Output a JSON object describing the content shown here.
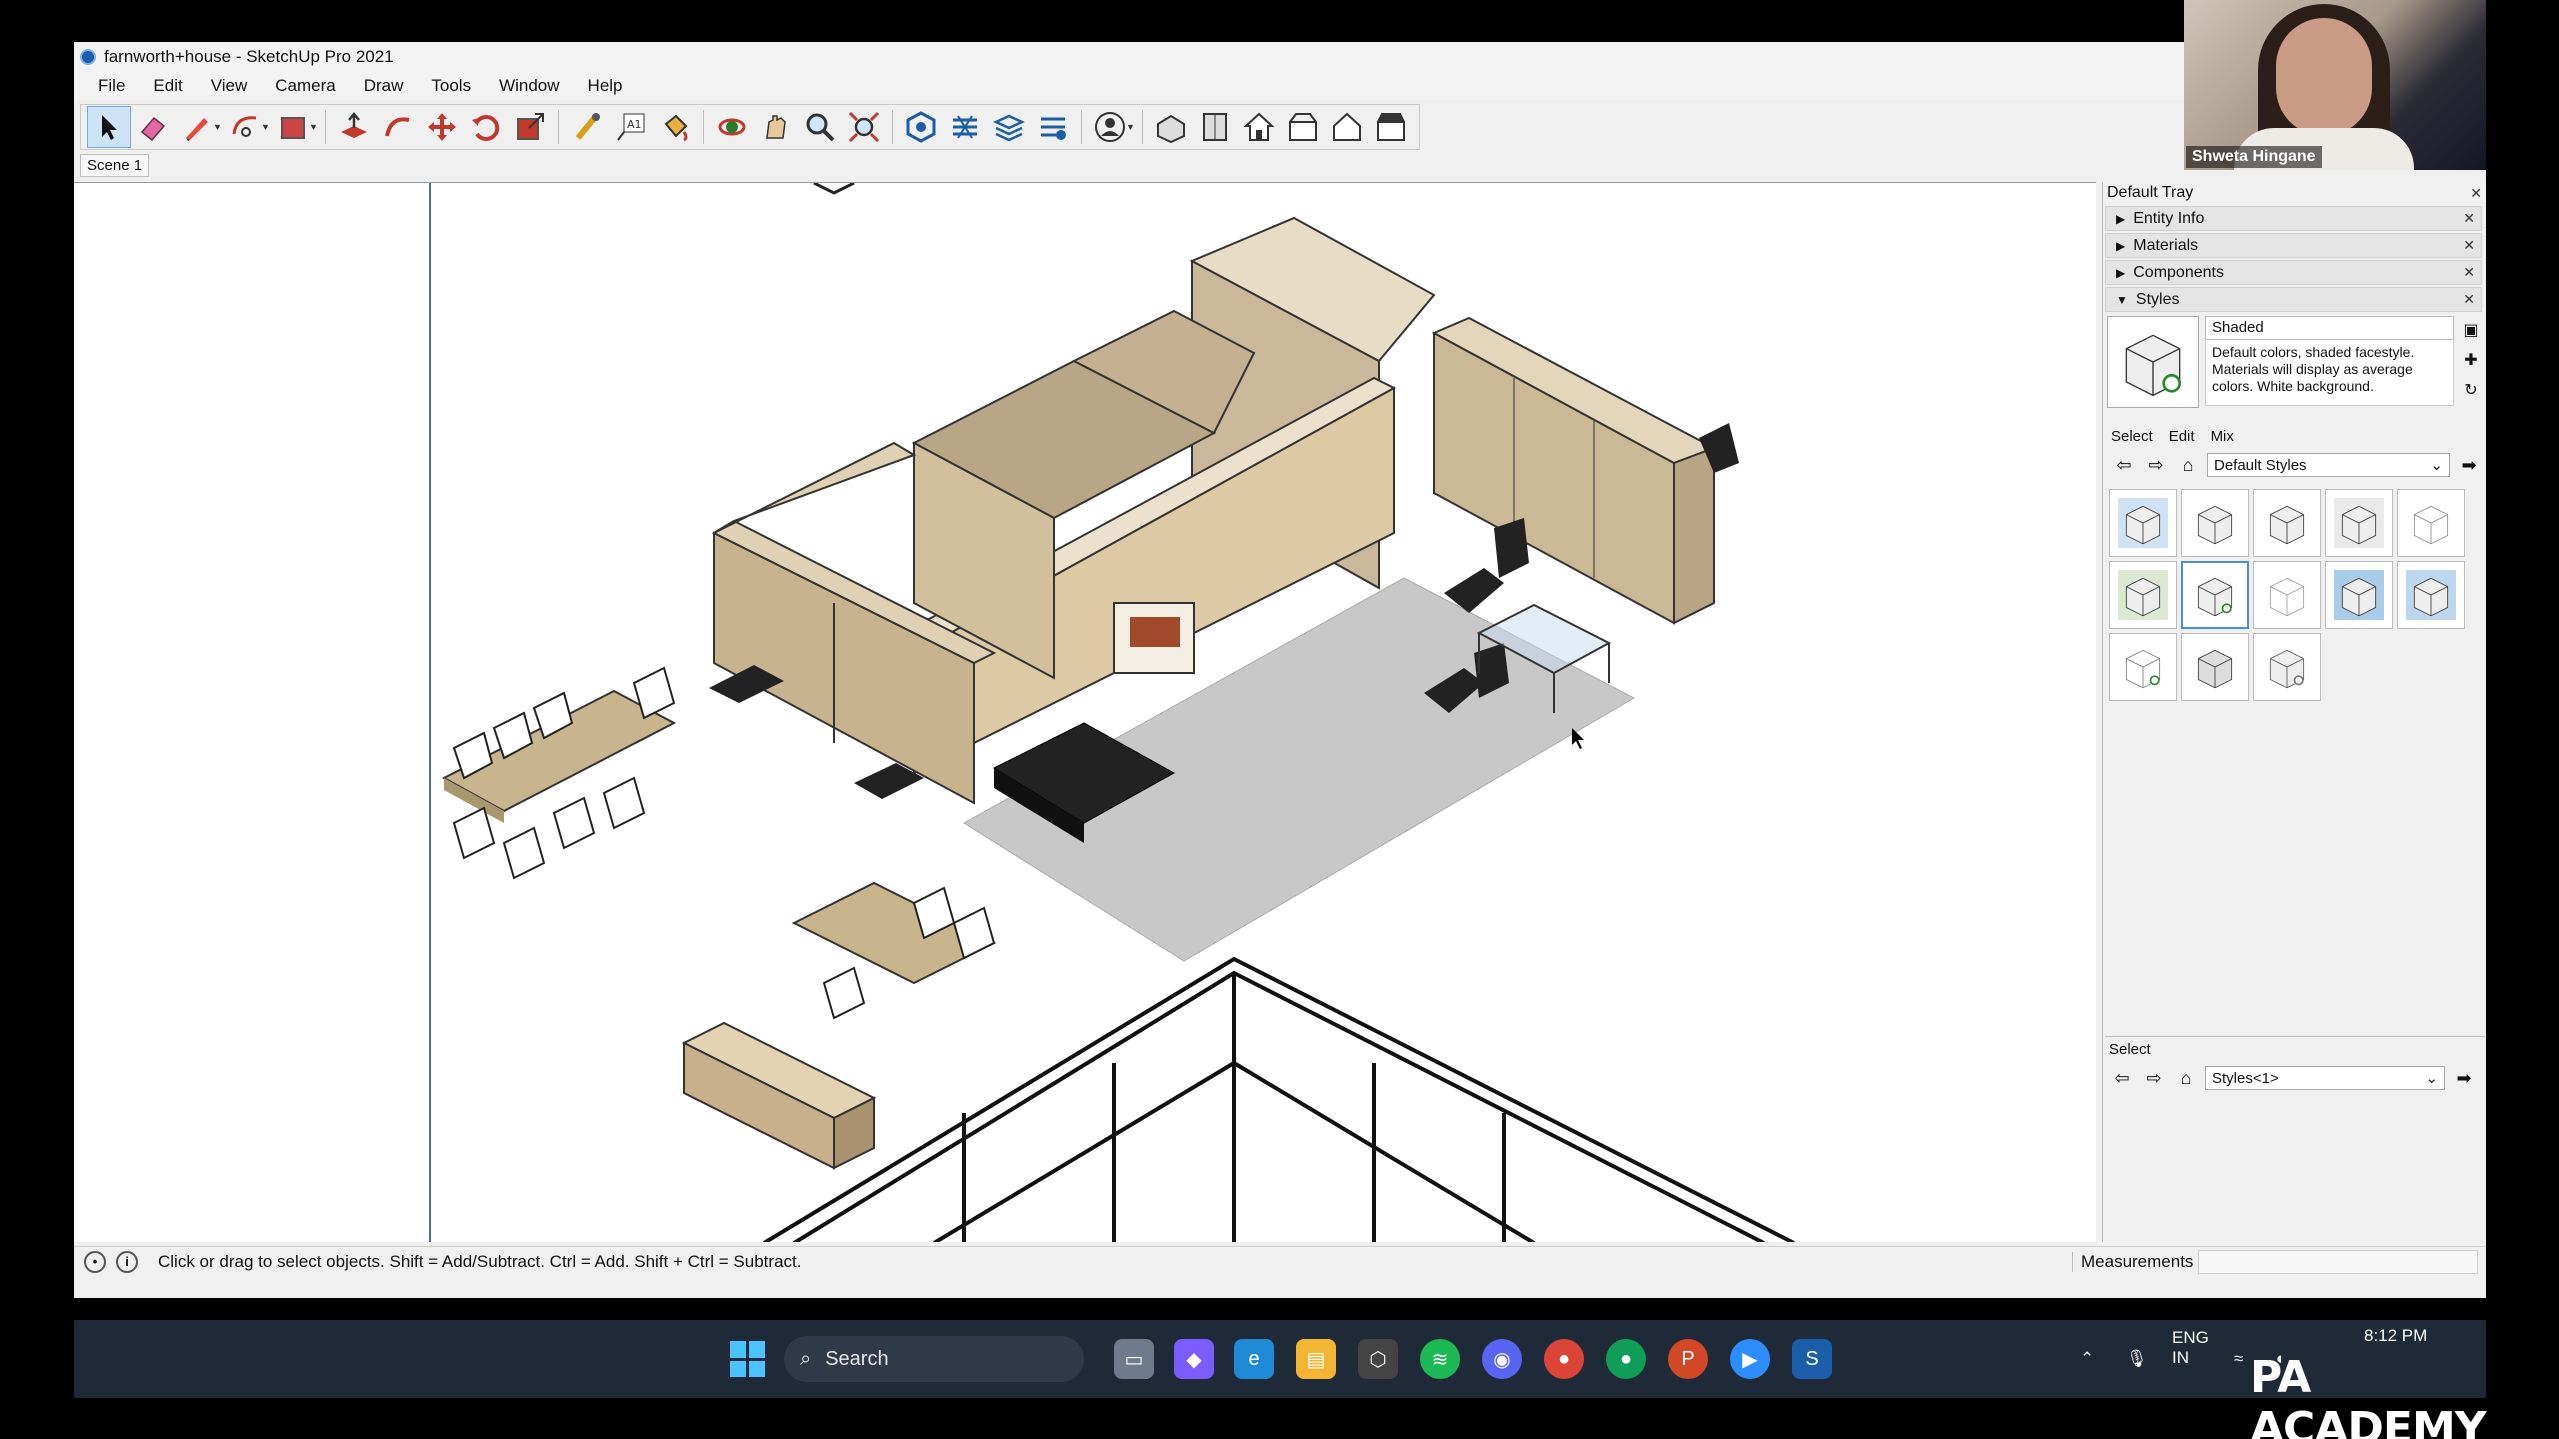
{
  "window": {
    "title": "farnworth+house - SketchUp Pro 2021"
  },
  "menu": [
    "File",
    "Edit",
    "View",
    "Camera",
    "Draw",
    "Tools",
    "Window",
    "Help"
  ],
  "scene_tab": "Scene 1",
  "tray": {
    "title": "Default Tray",
    "sections": [
      "Entity Info",
      "Materials",
      "Components",
      "Styles"
    ],
    "style": {
      "name": "Shaded",
      "description": "Default colors, shaded facestyle.  Materials will display as average colors.  White background."
    },
    "tabs": [
      "Select",
      "Edit",
      "Mix"
    ],
    "library": "Default Styles",
    "lower_title": "Select",
    "lower_library": "Styles<1>"
  },
  "status": {
    "hint": "Click or drag to select objects. Shift = Add/Subtract. Ctrl = Add. Shift + Ctrl = Subtract.",
    "measurements_label": "Measurements"
  },
  "taskbar": {
    "search": "Search",
    "lang": "ENG",
    "region": "IN",
    "time": "8:12 PM"
  },
  "webcam": {
    "name": "Shweta Hingane"
  },
  "watermark": "PA ACADEMY",
  "colors": {
    "accent": "#4a8ed6",
    "wall": "#d9c7a6",
    "floor": "#c8c8c8"
  }
}
